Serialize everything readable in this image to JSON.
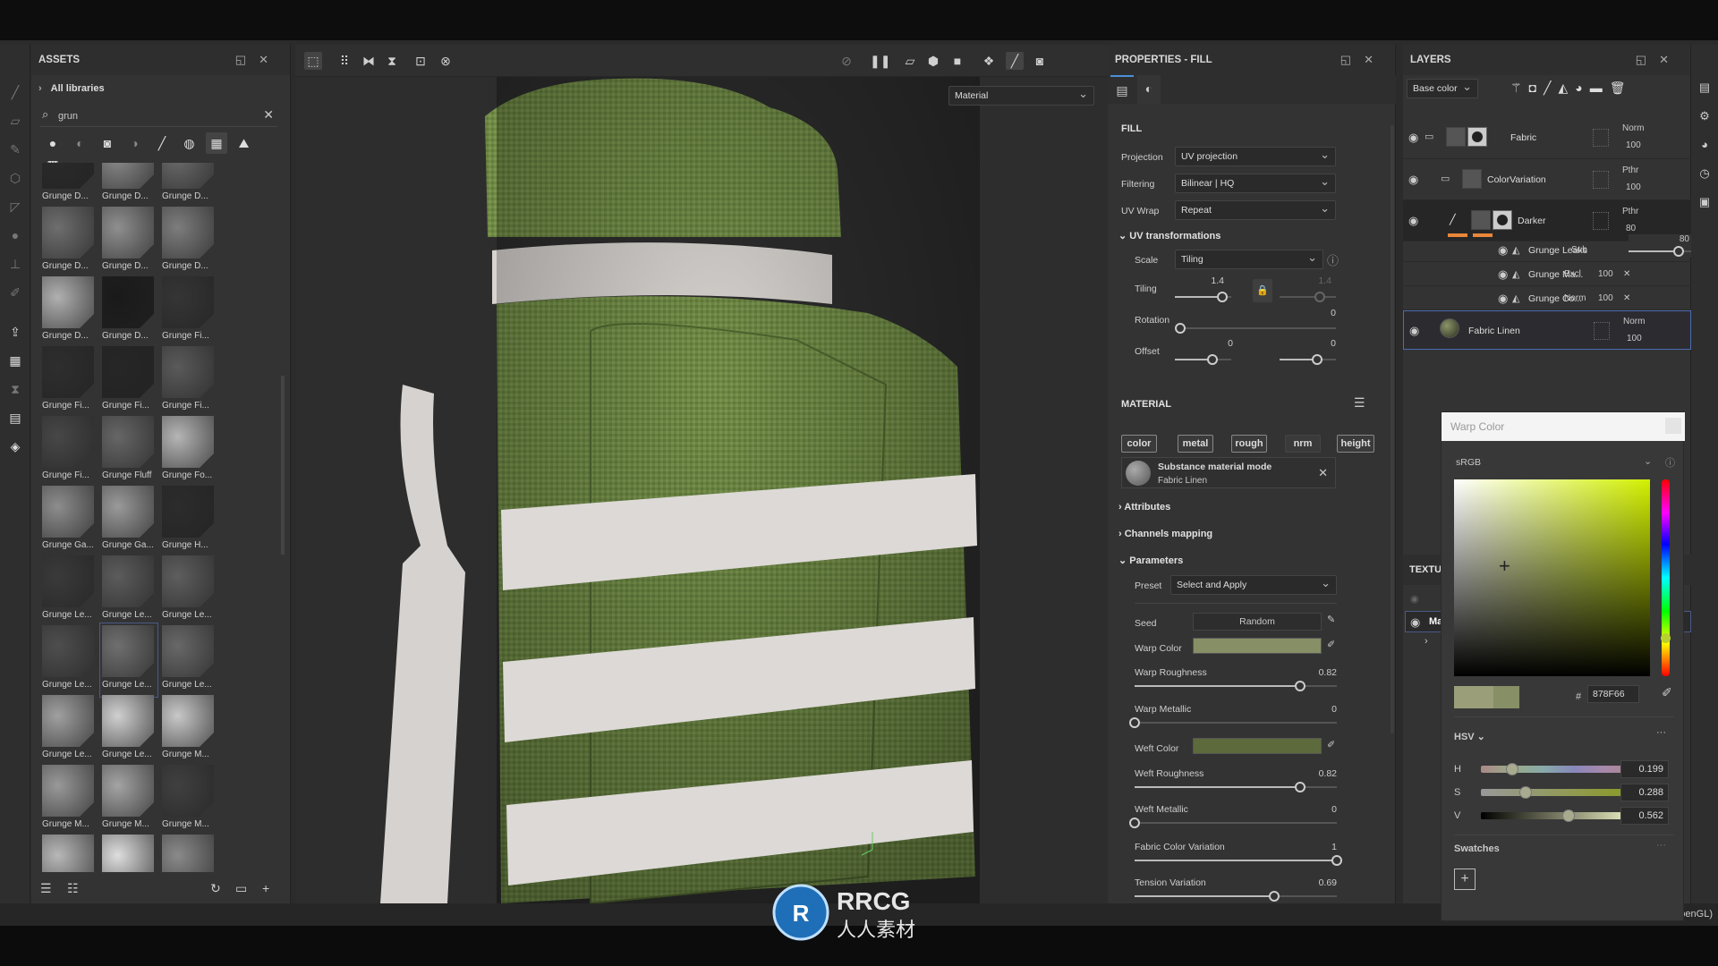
{
  "assets": {
    "title": "ASSETS",
    "library": "All libraries",
    "search": "grun",
    "items": [
      [
        "Grunge D...",
        "#2a2a2a"
      ],
      [
        "Grunge D...",
        "#8a8a8a"
      ],
      [
        "Grunge D...",
        "#6a6a6a"
      ],
      [
        "Grunge D...",
        "#6e6e6e"
      ],
      [
        "Grunge D...",
        "#8f8f8f"
      ],
      [
        "Grunge D...",
        "#7d7d7d"
      ],
      [
        "Grunge D...",
        "#b0b0b0"
      ],
      [
        "Grunge D...",
        "#1a1a1a"
      ],
      [
        "Grunge Fi...",
        "#353535"
      ],
      [
        "Grunge Fi...",
        "#2e2e2e"
      ],
      [
        "Grunge Fi...",
        "#262626"
      ],
      [
        "Grunge Fi...",
        "#5a5a5a"
      ],
      [
        "Grunge Fi...",
        "#474747"
      ],
      [
        "Grunge Fluff",
        "#666666"
      ],
      [
        "Grunge Fo...",
        "#b5b5b5"
      ],
      [
        "Grunge Ga...",
        "#8d8d8d"
      ],
      [
        "Grunge Ga...",
        "#9a9a9a"
      ],
      [
        "Grunge H...",
        "#2c2c2c"
      ],
      [
        "Grunge Le...",
        "#3a3a3a"
      ],
      [
        "Grunge Le...",
        "#5c5c5c"
      ],
      [
        "Grunge Le...",
        "#5e5e5e"
      ],
      [
        "Grunge Le...",
        "#4e4e4e"
      ],
      [
        "Grunge Le...",
        "#6f6f6f"
      ],
      [
        "Grunge Le...",
        "#686868"
      ],
      [
        "Grunge Le...",
        "#a0a0a0"
      ],
      [
        "Grunge Le...",
        "#d0d0d0"
      ],
      [
        "Grunge M...",
        "#c8c8c8"
      ],
      [
        "Grunge M...",
        "#999999"
      ],
      [
        "Grunge M...",
        "#a4a4a4"
      ],
      [
        "Grunge M...",
        "#404040"
      ],
      [
        "",
        "#b8b8b8"
      ],
      [
        "",
        "#dedede"
      ],
      [
        "",
        "#8a8a8a"
      ]
    ],
    "selected_index": 22
  },
  "viewport": {
    "channel_select": "Material",
    "watermark": "RRCG 人人素材"
  },
  "properties": {
    "title": "PROPERTIES - FILL",
    "fill_heading": "FILL",
    "projection": {
      "label": "Projection",
      "value": "UV projection"
    },
    "filtering": {
      "label": "Filtering",
      "value": "Bilinear | HQ"
    },
    "uvwrap": {
      "label": "UV Wrap",
      "value": "Repeat"
    },
    "uvtrans": "UV transformations",
    "scale": {
      "label": "Scale",
      "value": "Tiling"
    },
    "tiling": {
      "label": "Tiling",
      "u": "1.4",
      "v": "1.4"
    },
    "rotation": {
      "label": "Rotation",
      "value": "0"
    },
    "offset": {
      "label": "Offset",
      "u": "0",
      "v": "0"
    },
    "material_heading": "MATERIAL",
    "channels": [
      "color",
      "metal",
      "rough",
      "nrm",
      "height"
    ],
    "substance": {
      "title": "Substance material mode",
      "name": "Fabric Linen"
    },
    "attributes": "Attributes",
    "channels_mapping": "Channels mapping",
    "parameters": "Parameters",
    "preset": {
      "label": "Preset",
      "value": "Select and Apply"
    },
    "seed": {
      "label": "Seed",
      "value": "Random"
    },
    "warp_color": {
      "label": "Warp Color",
      "color": "#878F66"
    },
    "weft_color": {
      "label": "Weft Color",
      "color": "#5c6a3c"
    },
    "sliders": [
      {
        "label": "Warp Roughness",
        "value": "0.82",
        "fraction": 0.82
      },
      {
        "label": "Warp Metallic",
        "value": "0",
        "fraction": 0
      },
      {
        "label": "Weft Roughness",
        "value": "0.82",
        "fraction": 0.82
      },
      {
        "label": "Weft Metallic",
        "value": "0",
        "fraction": 0
      },
      {
        "label": "Fabric Color Variation",
        "value": "1",
        "fraction": 1
      },
      {
        "label": "Tension Variation",
        "value": "0.69",
        "fraction": 0.69
      }
    ]
  },
  "layers": {
    "title": "LAYERS",
    "channel": "Base color",
    "rows": [
      {
        "name": "Fabric",
        "blend": "Norm",
        "opacity": "100"
      },
      {
        "name": "ColorVariation",
        "blend": "Pthr",
        "opacity": "100"
      },
      {
        "name": "Darker",
        "blend": "Pthr",
        "opacity": "80"
      },
      {
        "name": "Grunge Leaks",
        "blend": "Sub",
        "opacity": "80"
      },
      {
        "name": "Grunge Ma...",
        "blend": "Excl",
        "opacity": "100"
      },
      {
        "name": "Grunge Co...",
        "blend": "Norm",
        "opacity": "100"
      },
      {
        "name": "Fabric Linen",
        "blend": "Norm",
        "opacity": "100"
      }
    ],
    "accent": "#e8873a",
    "textures_heading": "TEXTU",
    "texture_item": "Ma"
  },
  "color_picker": {
    "title": "Warp Color",
    "space": "sRGB",
    "hex_prefix": "#",
    "hex": "878F66",
    "mode": "HSV",
    "h": {
      "label": "H",
      "value": "0.199"
    },
    "s": {
      "label": "S",
      "value": "0.288"
    },
    "v": {
      "label": "V",
      "value": "0.562"
    },
    "swatches": "Swatches",
    "color": "#878F66"
  },
  "status": {
    "renderer": "(OpenGL)"
  }
}
